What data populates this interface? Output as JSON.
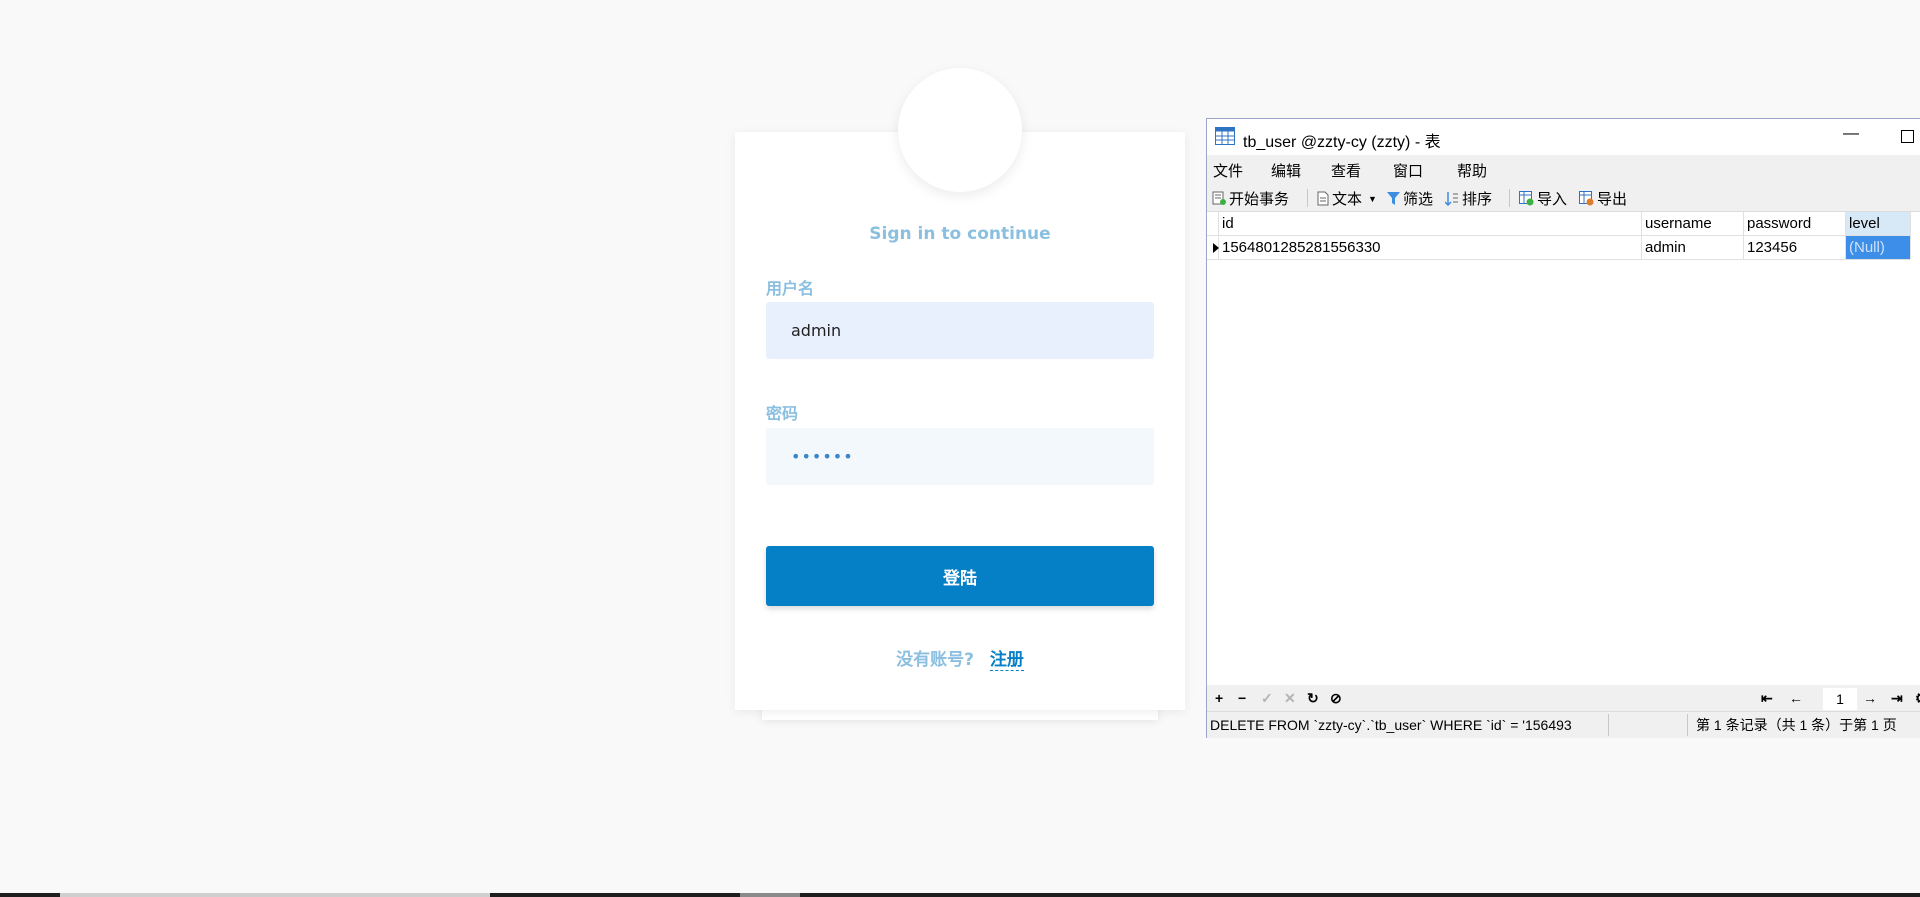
{
  "login": {
    "signin_text": "Sign in to continue",
    "username_label": "用户名",
    "username_value": "admin",
    "password_label": "密码",
    "password_value": "123456",
    "login_button": "登陆",
    "no_account": "没有账号?",
    "register_link": "注册"
  },
  "window": {
    "title": "tb_user @zzty-cy (zzty) - 表",
    "menu": [
      "文件",
      "编辑",
      "查看",
      "窗口",
      "帮助"
    ],
    "toolbar": {
      "begin_transaction": "开始事务",
      "text": "文本",
      "filter": "筛选",
      "sort": "排序",
      "import": "导入",
      "export": "导出"
    },
    "columns": [
      "id",
      "username",
      "password",
      "level"
    ],
    "rows": [
      {
        "id": "1564801285281556330",
        "username": "admin",
        "password": "123456",
        "level": "(Null)"
      }
    ],
    "page_number": "1",
    "status_sql": "DELETE FROM `zzty-cy`.`tb_user` WHERE `id` = '156493",
    "record_info": "第 1 条记录（共 1 条）于第 1 页"
  },
  "colors": {
    "accent": "#0580c6",
    "label_blue": "#8bbfe0",
    "null_cell": "#3d8ee8"
  }
}
